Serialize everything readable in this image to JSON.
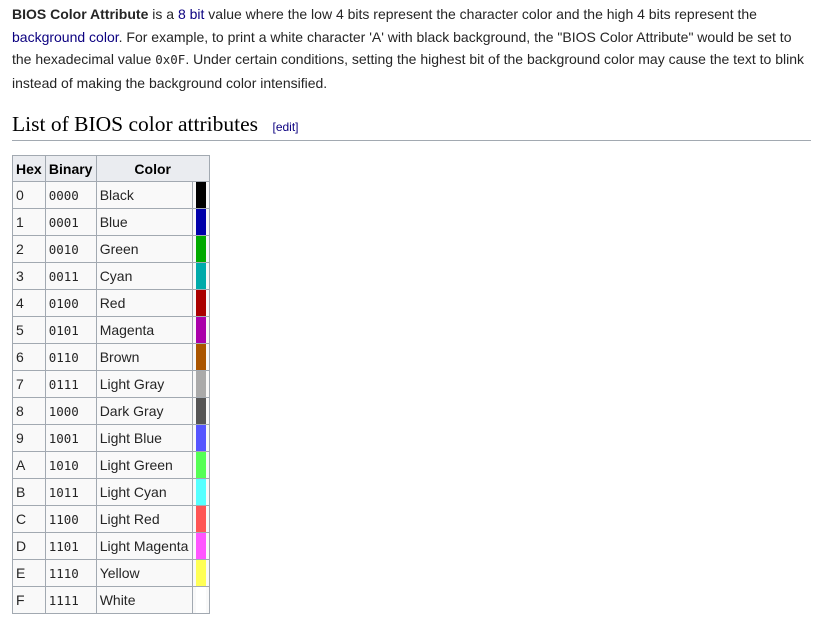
{
  "intro": {
    "term": "BIOS Color Attribute",
    "part1": " is a ",
    "link_8bit": "8 bit",
    "part2": " value where the low 4 bits represent the character color and the high 4 bits represent the ",
    "link_bg": "background color",
    "part3": ". For example, to print a white character 'A' with black background, the \"BIOS Color Attribute\" would be set to the hexadecimal value ",
    "code": "0x0F",
    "part4": ". Under certain conditions, setting the highest bit of the background color may cause the text to blink instead of making the background color intensified."
  },
  "section": {
    "title": "List of BIOS color attributes",
    "edit": "[edit]"
  },
  "table": {
    "headers": {
      "hex": "Hex",
      "binary": "Binary",
      "color": "Color"
    },
    "rows": [
      {
        "hex": "0",
        "binary": "0000",
        "name": "Black",
        "swatch": "#000000"
      },
      {
        "hex": "1",
        "binary": "0001",
        "name": "Blue",
        "swatch": "#0000aa"
      },
      {
        "hex": "2",
        "binary": "0010",
        "name": "Green",
        "swatch": "#00aa00"
      },
      {
        "hex": "3",
        "binary": "0011",
        "name": "Cyan",
        "swatch": "#00aaaa"
      },
      {
        "hex": "4",
        "binary": "0100",
        "name": "Red",
        "swatch": "#aa0000"
      },
      {
        "hex": "5",
        "binary": "0101",
        "name": "Magenta",
        "swatch": "#aa00aa"
      },
      {
        "hex": "6",
        "binary": "0110",
        "name": "Brown",
        "swatch": "#aa5500"
      },
      {
        "hex": "7",
        "binary": "0111",
        "name": "Light Gray",
        "swatch": "#aaaaaa"
      },
      {
        "hex": "8",
        "binary": "1000",
        "name": "Dark Gray",
        "swatch": "#555555"
      },
      {
        "hex": "9",
        "binary": "1001",
        "name": "Light Blue",
        "swatch": "#5555ff"
      },
      {
        "hex": "A",
        "binary": "1010",
        "name": "Light Green",
        "swatch": "#55ff55"
      },
      {
        "hex": "B",
        "binary": "1011",
        "name": "Light Cyan",
        "swatch": "#55ffff"
      },
      {
        "hex": "C",
        "binary": "1100",
        "name": "Light Red",
        "swatch": "#ff5555"
      },
      {
        "hex": "D",
        "binary": "1101",
        "name": "Light Magenta",
        "swatch": "#ff55ff"
      },
      {
        "hex": "E",
        "binary": "1110",
        "name": "Yellow",
        "swatch": "#ffff55"
      },
      {
        "hex": "F",
        "binary": "1111",
        "name": "White",
        "swatch": "#ffffff"
      }
    ]
  }
}
